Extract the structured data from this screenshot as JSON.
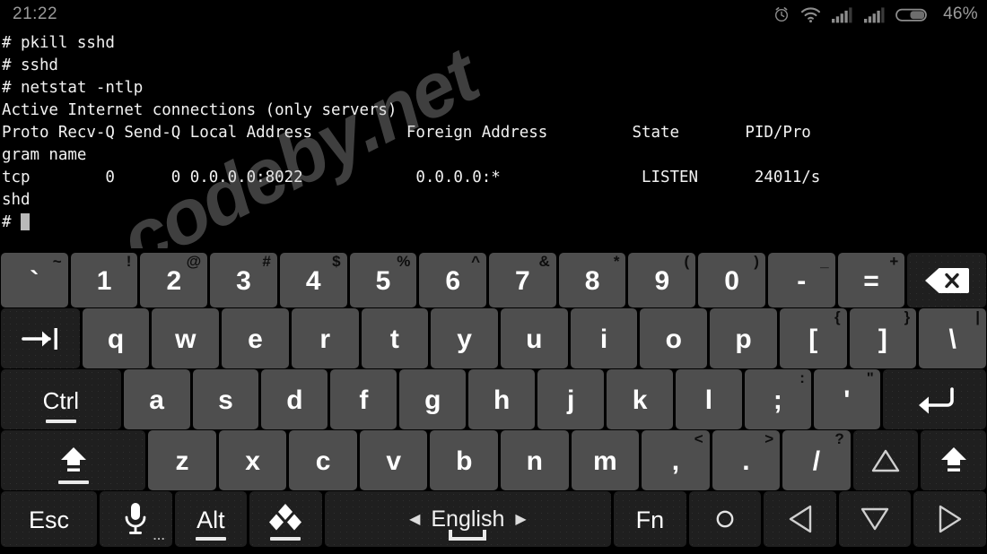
{
  "statusbar": {
    "clock": "21:22",
    "battery_percent": "46%",
    "icons": [
      "alarm-clock-icon",
      "wifi-icon",
      "signal-sim1-icon",
      "signal-sim2-icon",
      "battery-icon"
    ]
  },
  "watermark": {
    "text": "codeby.net"
  },
  "terminal": {
    "lines": [
      "# pkill sshd",
      "# sshd",
      "# netstat -ntlp",
      "Active Internet connections (only servers)",
      "Proto Recv-Q Send-Q Local Address          Foreign Address         State       PID/Pro",
      "gram name",
      "tcp        0      0 0.0.0.0:8022            0.0.0.0:*               LISTEN      24011/s",
      "shd"
    ],
    "prompt": "# ",
    "cursor": "block"
  },
  "keyboard": {
    "language": "English",
    "row1": [
      {
        "main": "`",
        "sup": "~",
        "name": "key-backtick"
      },
      {
        "main": "1",
        "sup": "!",
        "name": "key-1"
      },
      {
        "main": "2",
        "sup": "@",
        "name": "key-2"
      },
      {
        "main": "3",
        "sup": "#",
        "name": "key-3"
      },
      {
        "main": "4",
        "sup": "$",
        "name": "key-4"
      },
      {
        "main": "5",
        "sup": "%",
        "name": "key-5"
      },
      {
        "main": "6",
        "sup": "^",
        "name": "key-6"
      },
      {
        "main": "7",
        "sup": "&",
        "name": "key-7"
      },
      {
        "main": "8",
        "sup": "*",
        "name": "key-8"
      },
      {
        "main": "9",
        "sup": "(",
        "name": "key-9"
      },
      {
        "main": "0",
        "sup": ")",
        "name": "key-0"
      },
      {
        "main": "-",
        "sup": "_",
        "name": "key-minus"
      },
      {
        "main": "=",
        "sup": "+",
        "name": "key-equals"
      },
      {
        "main": "",
        "sup": "",
        "name": "key-backspace",
        "icon": "backspace-icon",
        "dark": true
      }
    ],
    "row2": [
      {
        "main": "",
        "sup": "",
        "name": "key-tab",
        "icon": "tab-icon",
        "dark": true
      },
      {
        "main": "q",
        "sup": "",
        "name": "key-q"
      },
      {
        "main": "w",
        "sup": "",
        "name": "key-w"
      },
      {
        "main": "e",
        "sup": "",
        "name": "key-e"
      },
      {
        "main": "r",
        "sup": "",
        "name": "key-r"
      },
      {
        "main": "t",
        "sup": "",
        "name": "key-t"
      },
      {
        "main": "y",
        "sup": "",
        "name": "key-y"
      },
      {
        "main": "u",
        "sup": "",
        "name": "key-u"
      },
      {
        "main": "i",
        "sup": "",
        "name": "key-i"
      },
      {
        "main": "o",
        "sup": "",
        "name": "key-o"
      },
      {
        "main": "p",
        "sup": "",
        "name": "key-p"
      },
      {
        "main": "[",
        "sup": "{",
        "name": "key-bracket-left"
      },
      {
        "main": "]",
        "sup": "}",
        "name": "key-bracket-right"
      },
      {
        "main": "\\",
        "sup": "|",
        "name": "key-backslash"
      }
    ],
    "row3": [
      {
        "main": "Ctrl",
        "sup": "",
        "name": "key-ctrl",
        "dark": true,
        "underbar": true,
        "small": true
      },
      {
        "main": "a",
        "sup": "",
        "name": "key-a"
      },
      {
        "main": "s",
        "sup": "",
        "name": "key-s"
      },
      {
        "main": "d",
        "sup": "",
        "name": "key-d"
      },
      {
        "main": "f",
        "sup": "",
        "name": "key-f"
      },
      {
        "main": "g",
        "sup": "",
        "name": "key-g"
      },
      {
        "main": "h",
        "sup": "",
        "name": "key-h"
      },
      {
        "main": "j",
        "sup": "",
        "name": "key-j"
      },
      {
        "main": "k",
        "sup": "",
        "name": "key-k"
      },
      {
        "main": "l",
        "sup": "",
        "name": "key-l"
      },
      {
        "main": ";",
        "sup": ":",
        "name": "key-semicolon"
      },
      {
        "main": "'",
        "sup": "\"",
        "name": "key-quote"
      },
      {
        "main": "",
        "sup": "",
        "name": "key-enter",
        "icon": "enter-icon",
        "dark": true
      }
    ],
    "row4": [
      {
        "main": "",
        "sup": "",
        "name": "key-shift-left",
        "icon": "shift-icon",
        "dark": true,
        "underbar": true
      },
      {
        "main": "z",
        "sup": "",
        "name": "key-z"
      },
      {
        "main": "x",
        "sup": "",
        "name": "key-x"
      },
      {
        "main": "c",
        "sup": "",
        "name": "key-c"
      },
      {
        "main": "v",
        "sup": "",
        "name": "key-v"
      },
      {
        "main": "b",
        "sup": "",
        "name": "key-b"
      },
      {
        "main": "n",
        "sup": "",
        "name": "key-n"
      },
      {
        "main": "m",
        "sup": "",
        "name": "key-m"
      },
      {
        "main": ",",
        "sup": "<",
        "name": "key-comma"
      },
      {
        "main": ".",
        "sup": ">",
        "name": "key-period"
      },
      {
        "main": "/",
        "sup": "?",
        "name": "key-slash"
      },
      {
        "main": "",
        "sup": "",
        "name": "key-arrow-up",
        "icon": "arrow-up-icon",
        "dark": true
      },
      {
        "main": "",
        "sup": "",
        "name": "key-shift-right",
        "icon": "shift-icon",
        "dark": true
      }
    ],
    "row5": [
      {
        "main": "Esc",
        "sup": "",
        "name": "key-esc",
        "dark": true,
        "esc": true
      },
      {
        "main": "",
        "sup": "",
        "name": "key-microphone",
        "icon": "microphone-icon",
        "dark": true,
        "dots": "..."
      },
      {
        "main": "Alt",
        "sup": "",
        "name": "key-alt",
        "dark": true,
        "underbar": true,
        "esc": true
      },
      {
        "main": "",
        "sup": "",
        "name": "key-input-method",
        "icon": "diamonds-icon",
        "dark": true,
        "underbar": true
      },
      {
        "main": "English",
        "sup": "",
        "name": "key-spacebar",
        "dark": true,
        "lang": true
      },
      {
        "main": "Fn",
        "sup": "",
        "name": "key-fn",
        "dark": true,
        "esc": true
      },
      {
        "main": "",
        "sup": "",
        "name": "key-circle",
        "icon": "circle-icon",
        "dark": true
      },
      {
        "main": "",
        "sup": "",
        "name": "key-arrow-left",
        "icon": "arrow-left-icon",
        "dark": true
      },
      {
        "main": "",
        "sup": "",
        "name": "key-arrow-down",
        "icon": "arrow-down-icon",
        "dark": true
      },
      {
        "main": "",
        "sup": "",
        "name": "key-arrow-right",
        "icon": "arrow-right-icon",
        "dark": true
      }
    ]
  }
}
